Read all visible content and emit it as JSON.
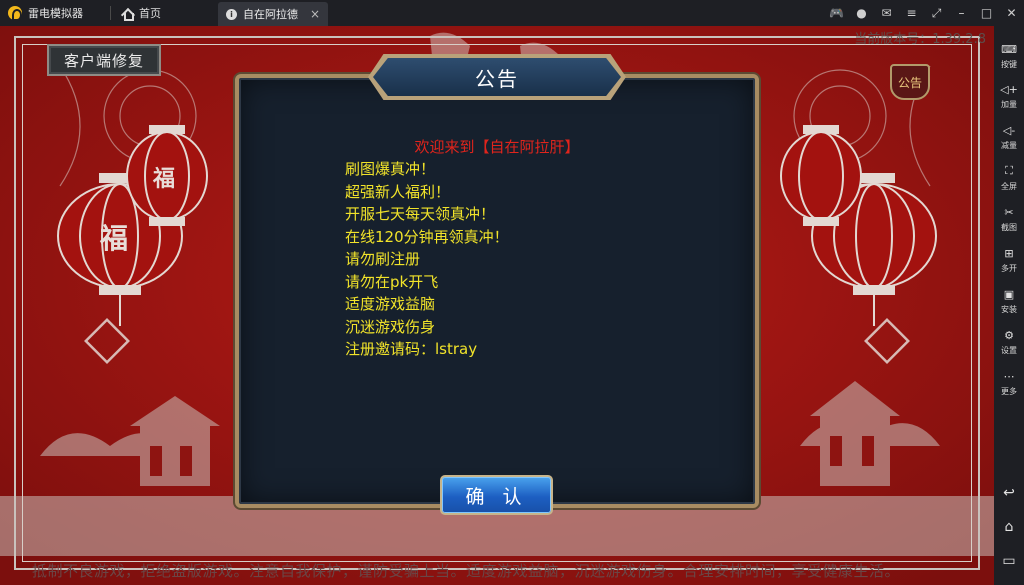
{
  "emulator": {
    "app_name": "雷电模拟器",
    "home_label": "首页",
    "tab_title": "自在阿拉德",
    "tab_close": "×",
    "buttons": [
      "gamepad-icon",
      "user-icon",
      "mail-icon",
      "menu-icon",
      "pin-icon",
      "minimize-icon",
      "maximize-icon",
      "close-icon"
    ],
    "button_glyphs": [
      "🎮",
      "●",
      "✉",
      "≡",
      "⤢",
      "–",
      "□",
      "✕"
    ]
  },
  "sidebar": {
    "items": [
      {
        "icon": "keyboard-icon",
        "glyph": "⌨",
        "label": "按键"
      },
      {
        "icon": "volume-up-icon",
        "glyph": "◁+",
        "label": "加量"
      },
      {
        "icon": "volume-down-icon",
        "glyph": "◁-",
        "label": "减量"
      },
      {
        "icon": "fullscreen-icon",
        "glyph": "⛶",
        "label": "全屏"
      },
      {
        "icon": "scissors-icon",
        "glyph": "✂",
        "label": "截图"
      },
      {
        "icon": "multi-open-icon",
        "glyph": "⊞",
        "label": "多开"
      },
      {
        "icon": "apk-icon",
        "glyph": "▣",
        "label": "安装"
      },
      {
        "icon": "settings-icon",
        "glyph": "⚙",
        "label": "设置"
      },
      {
        "icon": "more-icon",
        "glyph": "⋯",
        "label": "更多"
      }
    ],
    "nav": [
      {
        "icon": "back-icon",
        "glyph": "↩"
      },
      {
        "icon": "home-nav-icon",
        "glyph": "⌂"
      },
      {
        "icon": "recent-apps-icon",
        "glyph": "▭"
      }
    ]
  },
  "game": {
    "repair_button": "客户端修复",
    "version": "当前版本号：1.39.2.8",
    "notice_badge": "公告",
    "ticker": "抵制不良游戏，拒绝盗版游戏。注意自我保护，谨防受骗上当。适度游戏益脑，沉迷游戏伤身。合理安排时间，享受健康生活。"
  },
  "dialog": {
    "title": "公告",
    "welcome": "欢迎来到【自在阿拉肝】",
    "lines": [
      "刷图爆真冲！",
      "超强新人福利！",
      "开服七天每天领真冲！",
      "在线120分钟再领真冲！",
      "请勿刷注册",
      "请勿在pk开飞",
      "适度游戏益脑",
      "沉迷游戏伤身",
      "注册邀请码：lstray"
    ],
    "confirm": "确 认"
  },
  "colors": {
    "background_red": "#9e1412",
    "dialog_bg": "#16202d",
    "welcome_red": "#e0241c",
    "notice_yellow": "#f1e32a",
    "button_blue": "#1d5fc2",
    "gold_border": "#a88c62"
  }
}
